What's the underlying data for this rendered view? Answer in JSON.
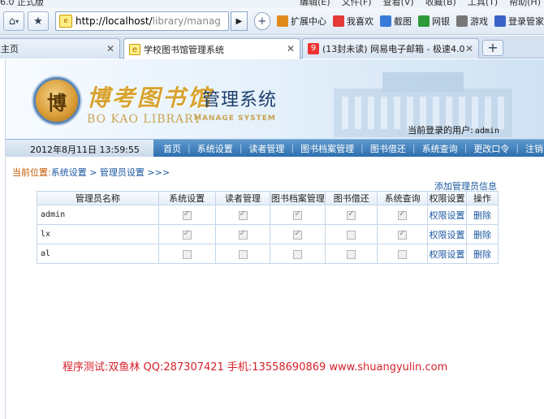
{
  "browser": {
    "menu_left": "6.0 正式版",
    "menu_right": [
      "编辑(E)",
      "文件(F)",
      "查看(V)",
      "收藏(B)",
      "工具(T)",
      "帮助(H)"
    ],
    "address": {
      "host": "http://localhost/",
      "path": "library/manag"
    },
    "bookmarks": [
      {
        "label": "扩展中心",
        "icon": "puzzle-icon",
        "color": "#e08a1e"
      },
      {
        "label": "我喜欢",
        "icon": "heart-icon",
        "color": "#e33a3a"
      },
      {
        "label": "截图",
        "icon": "scissors-icon",
        "color": "#3a7ad8"
      },
      {
        "label": "网银",
        "icon": "bank-icon",
        "color": "#2e9a3a"
      },
      {
        "label": "游戏",
        "icon": "gamepad-icon",
        "color": "#777777"
      },
      {
        "label": "登录管家",
        "icon": "key-icon",
        "color": "#3a62c8"
      }
    ],
    "tabs": [
      {
        "label": "主页"
      },
      {
        "label": "学校图书馆管理系统",
        "active": true
      },
      {
        "label": "(13封未读) 网易电子邮箱 - 极速4.0"
      }
    ]
  },
  "header": {
    "seal_char": "博",
    "logo_cn": "博考图书馆",
    "title": "管理系统",
    "logo_en": "BO KAO LIBRARY",
    "logo_en2": "MANAGE SYSTEM",
    "current_user_label": "当前登录的用户:",
    "current_user": "admin"
  },
  "navbar": {
    "datetime": "2012年8月11日  13:59:55",
    "items": [
      "首页",
      "系统设置",
      "读者管理",
      "图书档案管理",
      "图书借还",
      "系统查询",
      "更改口令",
      "注销"
    ]
  },
  "breadcrumb": {
    "prefix": "当前位置:",
    "path": "系统设置 > 管理员设置 >>>"
  },
  "add_admin_label": "添加管理员信息",
  "table": {
    "headers": [
      "管理员名称",
      "系统设置",
      "读者管理",
      "图书档案管理",
      "图书借还",
      "系统查询",
      "权限设置",
      "操作"
    ],
    "rows": [
      {
        "name": "admin",
        "perms": [
          true,
          true,
          true,
          true,
          true
        ],
        "perm_link": "权限设置",
        "action": "删除"
      },
      {
        "name": "lx",
        "perms": [
          true,
          true,
          true,
          false,
          true
        ],
        "perm_link": "权限设置",
        "action": "删除"
      },
      {
        "name": "al",
        "perms": [
          false,
          false,
          false,
          false,
          false
        ],
        "perm_link": "权限设置",
        "action": "删除"
      }
    ]
  },
  "footer_note": "程序测试:双鱼林 QQ:287307421 手机:13558690869 www.shuangyulin.com"
}
